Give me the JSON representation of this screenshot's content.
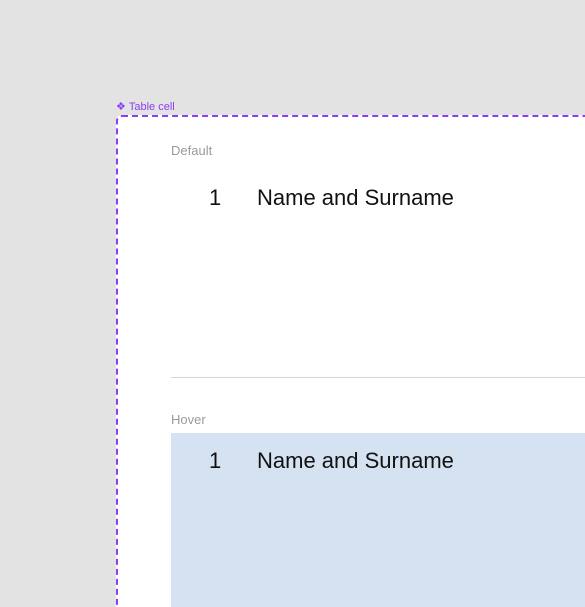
{
  "component": {
    "icon": "component-diamond-icon",
    "icon_glyph": "❖",
    "name": "Table cell"
  },
  "variants": {
    "default": {
      "label": "Default",
      "row": {
        "index": "1",
        "name": "Name and Surname"
      }
    },
    "hover": {
      "label": "Hover",
      "row": {
        "index": "1",
        "name": "Name and Surname"
      }
    }
  },
  "colors": {
    "component_accent": "#8a3ff5",
    "hover_background": "#d4e2f1",
    "canvas_background": "#e3e3e3"
  }
}
